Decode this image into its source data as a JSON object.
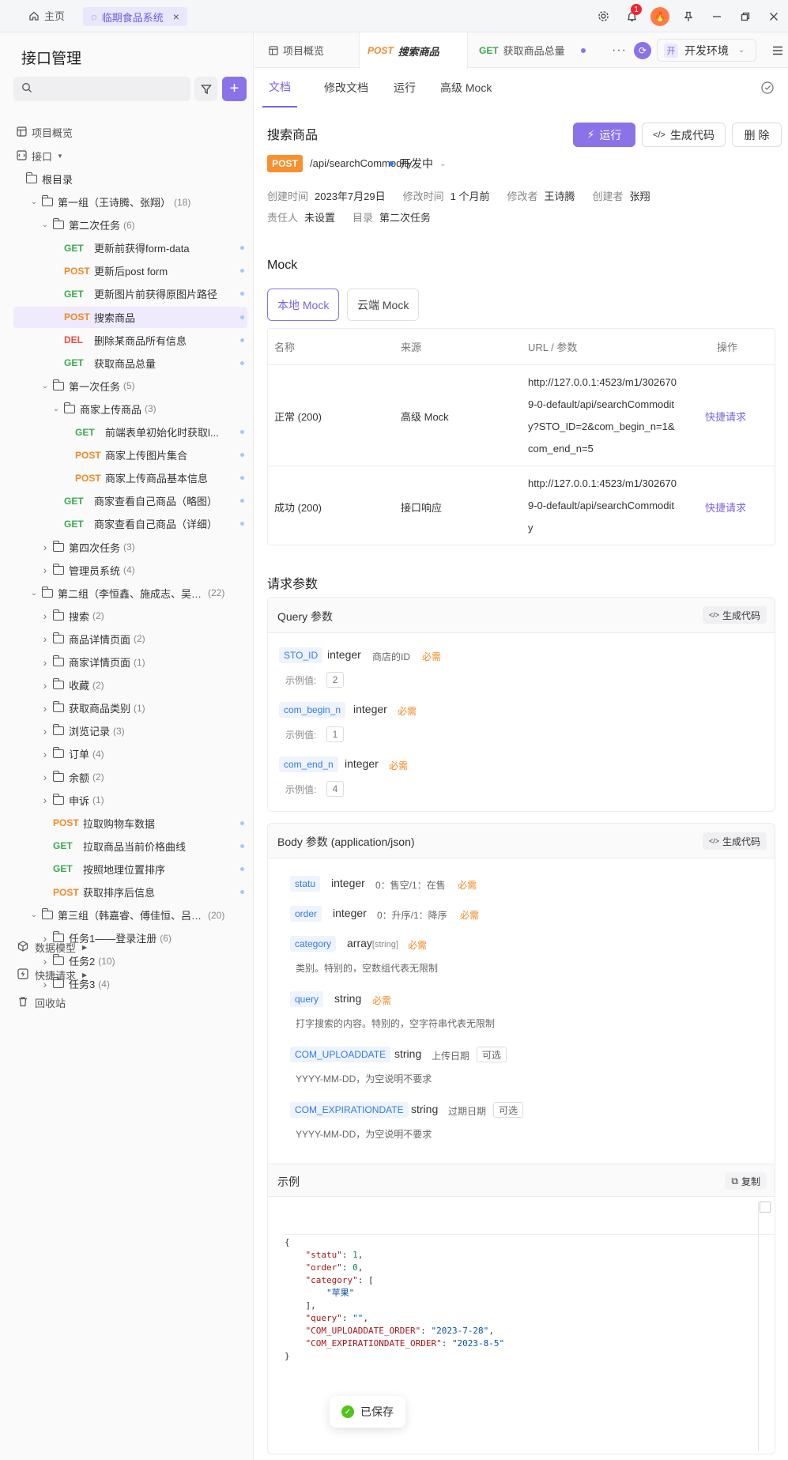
{
  "topbar": {
    "home": "主页",
    "tab": "临期食品系统",
    "notification_count": "1"
  },
  "sidebar": {
    "title": "接口管理",
    "search_placeholder": "",
    "overview": "项目概览",
    "api_root": "接口",
    "root_dir": "根目录",
    "tree": [
      {
        "type": "folder",
        "label": "第一组（王诗腾、张翔）",
        "count": "(18)"
      },
      {
        "type": "folder",
        "label": "第二次任务",
        "count": "(6)"
      },
      {
        "type": "api",
        "method": "GET",
        "label": "更新前获得form-data"
      },
      {
        "type": "api",
        "method": "POST",
        "label": "更新后post form"
      },
      {
        "type": "api",
        "method": "GET",
        "label": "更新图片前获得原图片路径"
      },
      {
        "type": "api",
        "method": "POST",
        "label": "搜索商品"
      },
      {
        "type": "api",
        "method": "DEL",
        "label": "删除某商品所有信息"
      },
      {
        "type": "api",
        "method": "GET",
        "label": "获取商品总量"
      },
      {
        "type": "folder",
        "label": "第一次任务",
        "count": "(5)"
      },
      {
        "type": "folder",
        "label": "商家上传商品",
        "count": "(3)"
      },
      {
        "type": "api",
        "method": "GET",
        "label": "前端表单初始化时获取l..."
      },
      {
        "type": "api",
        "method": "POST",
        "label": "商家上传图片集合"
      },
      {
        "type": "api",
        "method": "POST",
        "label": "商家上传商品基本信息"
      },
      {
        "type": "api",
        "method": "GET",
        "label": "商家查看自己商品（略图）"
      },
      {
        "type": "api",
        "method": "GET",
        "label": "商家查看自己商品（详细）"
      },
      {
        "type": "folder",
        "label": "第四次任务",
        "count": "(3)"
      },
      {
        "type": "folder",
        "label": "管理员系统",
        "count": "(4)"
      },
      {
        "type": "folder",
        "label": "第二组（李恒鑫、施成志、吴冠...",
        "count": "(22)"
      },
      {
        "type": "folder",
        "label": "搜索",
        "count": "(2)"
      },
      {
        "type": "folder",
        "label": "商品详情页面",
        "count": "(2)"
      },
      {
        "type": "folder",
        "label": "商家详情页面",
        "count": "(1)"
      },
      {
        "type": "folder",
        "label": "收藏",
        "count": "(2)"
      },
      {
        "type": "folder",
        "label": "获取商品类别",
        "count": "(1)"
      },
      {
        "type": "folder",
        "label": "浏览记录",
        "count": "(3)"
      },
      {
        "type": "folder",
        "label": "订单",
        "count": "(4)"
      },
      {
        "type": "folder",
        "label": "余额",
        "count": "(2)"
      },
      {
        "type": "folder",
        "label": "申诉",
        "count": "(1)"
      },
      {
        "type": "api",
        "method": "POST",
        "label": "拉取购物车数据"
      },
      {
        "type": "api",
        "method": "GET",
        "label": "拉取商品当前价格曲线"
      },
      {
        "type": "api",
        "method": "GET",
        "label": "按照地理位置排序"
      },
      {
        "type": "api",
        "method": "POST",
        "label": "获取排序后信息"
      },
      {
        "type": "folder",
        "label": "第三组（韩嘉睿、傅佳恒、吕骏...",
        "count": "(20)"
      },
      {
        "type": "folder",
        "label": "任务1——登录注册",
        "count": "(6)"
      },
      {
        "type": "folder",
        "label": "任务2",
        "count": "(10)"
      },
      {
        "type": "folder",
        "label": "任务3",
        "count": "(4)"
      }
    ],
    "data_model": "数据模型",
    "quick_request": "快捷请求",
    "recycle_bin": "回收站"
  },
  "main": {
    "tabs": [
      {
        "label": "项目概览"
      },
      {
        "method": "POST",
        "label": "搜索商品"
      },
      {
        "method": "GET",
        "label": "获取商品总量"
      }
    ],
    "env_key": "开",
    "env": "开发环境",
    "subtabs": [
      "文档",
      "修改文档",
      "运行",
      "高级 Mock"
    ],
    "api_name": "搜索商品",
    "run_btn": "运行",
    "gen_code_btn": "生成代码",
    "delete_btn": "删 除",
    "method": "POST",
    "path": "/api/searchCommodity",
    "status": "开发中",
    "meta1": {
      "created_label": "创建时间",
      "created": "2023年7月29日",
      "modified_label": "修改时间",
      "modified": "1 个月前",
      "modifier_label": "修改者",
      "modifier": "王诗腾",
      "creator_label": "创建者",
      "creator": "张翔"
    },
    "meta2": {
      "owner_label": "责任人",
      "owner": "未设置",
      "dir_label": "目录",
      "dir": "第二次任务"
    },
    "mock": {
      "title": "Mock",
      "local": "本地 Mock",
      "cloud": "云端 Mock",
      "headers": [
        "名称",
        "来源",
        "URL / 参数",
        "操作"
      ],
      "rows": [
        {
          "name": "正常 (200)",
          "source": "高级 Mock",
          "url": "http://127.0.0.1:4523/m1/3026709-0-default/api/searchCommodity?STO_ID=2&com_begin_n=1&com_end_n=5",
          "action": "快捷请求"
        },
        {
          "name": "成功 (200)",
          "source": "接口响应",
          "url": "http://127.0.0.1:4523/m1/3026709-0-default/api/searchCommodity",
          "action": "快捷请求"
        }
      ]
    },
    "req_title": "请求参数",
    "query": {
      "title": "Query 参数",
      "gen": "生成代码",
      "example_label": "示例值:",
      "params": [
        {
          "name": "STO_ID",
          "type": "integer",
          "desc": "商店的ID",
          "req": "必需",
          "example": "2"
        },
        {
          "name": "com_begin_n",
          "type": "integer",
          "desc": "",
          "req": "必需",
          "example": "1"
        },
        {
          "name": "com_end_n",
          "type": "integer",
          "desc": "",
          "req": "必需",
          "example": "4"
        }
      ]
    },
    "body": {
      "title": "Body 参数 (application/json)",
      "gen": "生成代码",
      "params": [
        {
          "name": "statu",
          "type": "integer",
          "desc": "0：售空/1：在售",
          "flag": "必需"
        },
        {
          "name": "order",
          "type": "integer",
          "desc": "0：升序/1：降序",
          "flag": "必需"
        },
        {
          "name": "category",
          "type": "array",
          "type_sub": "[string]",
          "desc": "",
          "flag": "必需",
          "note": "类别。特别的，空数组代表无限制"
        },
        {
          "name": "query",
          "type": "string",
          "desc": "",
          "flag": "必需",
          "note": "打字搜索的内容。特别的，空字符串代表无限制"
        },
        {
          "name": "COM_UPLOADDATE",
          "type": "string",
          "desc": "上传日期",
          "flag": "可选",
          "note": "YYYY-MM-DD，为空说明不要求"
        },
        {
          "name": "COM_EXPIRATIONDATE",
          "type": "string",
          "desc": "过期日期",
          "flag": "可选",
          "note": "YYYY-MM-DD，为空说明不要求"
        }
      ]
    },
    "example": {
      "title": "示例",
      "copy": "复制",
      "code": {
        "statu": "1",
        "order": "0",
        "category_item": "\"苹果\"",
        "query": "\"\"",
        "upload": "\"2023-7-28\"",
        "expire": "\"2023-8-5\""
      }
    },
    "toast": "已保存"
  }
}
